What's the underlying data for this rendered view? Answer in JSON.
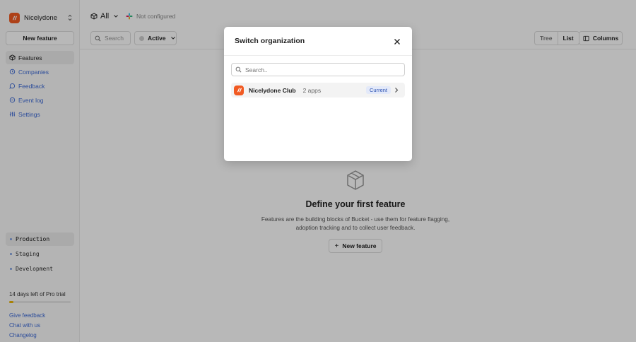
{
  "org": {
    "name": "Nicelydone"
  },
  "sidebar": {
    "new_feature_label": "New feature",
    "nav": [
      {
        "label": "Features",
        "icon": "box-icon",
        "active": true
      },
      {
        "label": "Companies",
        "icon": "building-icon"
      },
      {
        "label": "Feedback",
        "icon": "message-icon"
      },
      {
        "label": "Event log",
        "icon": "list-icon"
      },
      {
        "label": "Settings",
        "icon": "sliders-icon"
      }
    ],
    "environments": [
      "Production",
      "Staging",
      "Development"
    ],
    "trial_text": "14 days left of Pro trial",
    "trial_progress_percent": 7,
    "links": [
      "Give feedback",
      "Chat with us",
      "Changelog"
    ]
  },
  "topbar": {
    "env_label": "All",
    "integration_status": "Not configured",
    "search_placeholder": "Search",
    "status_filter": "Active",
    "view_tree": "Tree",
    "view_list": "List",
    "columns_label": "Columns"
  },
  "empty_state": {
    "title": "Define your first feature",
    "description": "Features are the building blocks of Bucket - use them for feature flagging, adoption tracking and to collect user feedback.",
    "button_label": "New feature"
  },
  "modal": {
    "title": "Switch organization",
    "search_placeholder": "Search..",
    "org_name": "Nicelydone Club",
    "org_apps": "2 apps",
    "badge": "Current"
  },
  "colors": {
    "brand": "#f15a22",
    "link": "#3d6ad6",
    "badge_bg": "#e3e9f9",
    "trial": "#e9b308"
  }
}
